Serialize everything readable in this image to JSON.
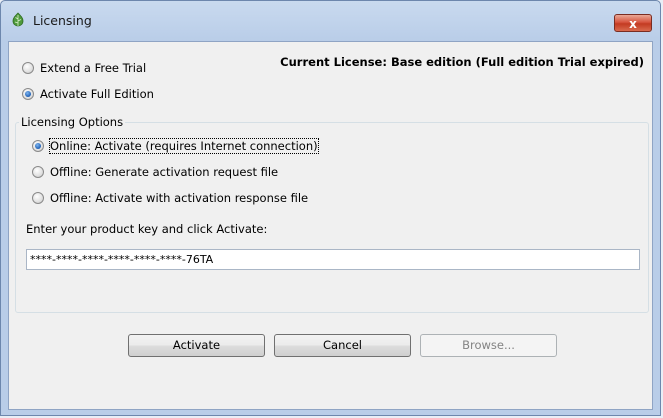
{
  "window": {
    "title": "Licensing",
    "close_label": "x"
  },
  "current_license": "Current License: Base edition (Full edition Trial expired)",
  "mode_options": [
    {
      "label": "Extend a Free Trial",
      "checked": false
    },
    {
      "label": "Activate Full Edition",
      "checked": true
    }
  ],
  "licensing_options": {
    "title": "Licensing Options",
    "options": [
      {
        "label": "Online: Activate (requires Internet connection)",
        "checked": true
      },
      {
        "label": "Offline: Generate activation request file",
        "checked": false
      },
      {
        "label": "Offline: Activate with activation response file",
        "checked": false
      }
    ],
    "prompt": "Enter your product key and click Activate:",
    "product_key": "****-****-****-****-****-****-76TA"
  },
  "buttons": {
    "activate": "Activate",
    "cancel": "Cancel",
    "browse": "Browse..."
  }
}
